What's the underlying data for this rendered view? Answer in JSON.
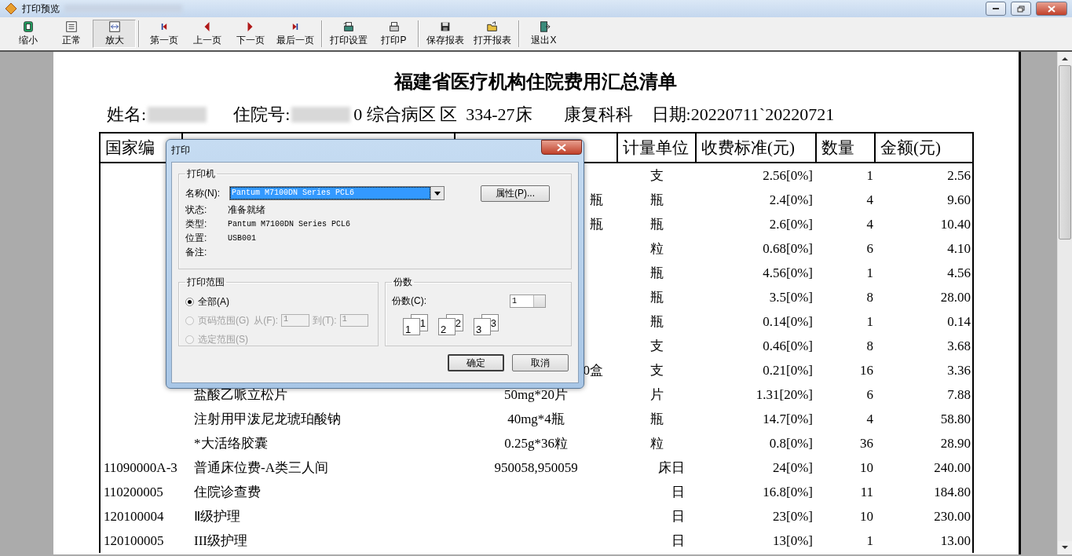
{
  "window": {
    "title": "打印预览"
  },
  "toolbar": [
    {
      "label": "缩小",
      "kind": "zoom-out",
      "pressed": false,
      "separator_before": false
    },
    {
      "label": "正常",
      "kind": "normal",
      "pressed": false,
      "separator_before": false
    },
    {
      "label": "放大",
      "kind": "zoom-in",
      "pressed": true,
      "separator_before": false
    },
    {
      "label": "第一页",
      "kind": "first",
      "pressed": false,
      "separator_before": true
    },
    {
      "label": "上一页",
      "kind": "prev",
      "pressed": false,
      "separator_before": false
    },
    {
      "label": "下一页",
      "kind": "next",
      "pressed": false,
      "separator_before": false
    },
    {
      "label": "最后一页",
      "kind": "last",
      "pressed": false,
      "separator_before": false
    },
    {
      "label": "打印设置",
      "kind": "print-setup",
      "pressed": false,
      "separator_before": true
    },
    {
      "label": "打印P",
      "kind": "print",
      "pressed": false,
      "separator_before": false
    },
    {
      "label": "保存报表",
      "kind": "save",
      "pressed": false,
      "separator_before": true
    },
    {
      "label": "打开报表",
      "kind": "open",
      "pressed": false,
      "separator_before": false
    },
    {
      "label": "退出X",
      "kind": "exit",
      "pressed": false,
      "separator_before": true
    }
  ],
  "report": {
    "title": "福建省医疗机构住院费用汇总清单",
    "name_label": "姓名:",
    "admission_label": "住院号:",
    "ward": "0 综合病区 区  334-27床",
    "department": "康复科科",
    "date": "日期:20220711`20220721",
    "columns": [
      "国家编",
      "计量单位",
      "收费标准(元)",
      "数量",
      "金额(元)"
    ],
    "rows": [
      {
        "kind": "drug",
        "unit": "支",
        "price": "2.56[0%]",
        "qty": "1",
        "amount": "2.56"
      },
      {
        "kind": "drug",
        "spec": "瓶",
        "unit": "瓶",
        "price": "2.4[0%]",
        "qty": "4",
        "amount": "9.60"
      },
      {
        "kind": "drug",
        "spec": "瓶",
        "unit": "瓶",
        "price": "2.6[0%]",
        "qty": "4",
        "amount": "10.40"
      },
      {
        "kind": "drug",
        "unit": "粒",
        "price": "0.68[0%]",
        "qty": "6",
        "amount": "4.10"
      },
      {
        "kind": "drug",
        "unit": "瓶",
        "price": "4.56[0%]",
        "qty": "1",
        "amount": "4.56"
      },
      {
        "kind": "drug",
        "unit": "瓶",
        "price": "3.5[0%]",
        "qty": "8",
        "amount": "28.00"
      },
      {
        "kind": "drug",
        "unit": "瓶",
        "price": "0.14[0%]",
        "qty": "1",
        "amount": "0.14"
      },
      {
        "kind": "drug",
        "unit": "支",
        "price": "0.46[0%]",
        "qty": "8",
        "amount": "3.68"
      },
      {
        "kind": "drug",
        "spec": "0盒",
        "unit": "支",
        "price": "0.21[0%]",
        "qty": "16",
        "amount": "3.36"
      },
      {
        "kind": "drug",
        "name": "盐酸乙哌立松片",
        "spec": "50mg*20片",
        "unit": "片",
        "price": "1.31[20%]",
        "qty": "6",
        "amount": "7.88"
      },
      {
        "kind": "drug",
        "name": "注射用甲泼尼龙琥珀酸钠",
        "spec": "40mg*4瓶",
        "unit": "瓶",
        "price": "14.7[0%]",
        "qty": "4",
        "amount": "58.80"
      },
      {
        "kind": "drug",
        "name": "*大活络胶囊",
        "spec": "0.25g*36粒",
        "unit": "粒",
        "price": "0.8[0%]",
        "qty": "36",
        "amount": "28.90"
      },
      {
        "kind": "service",
        "code": "11090000A-3",
        "name": "普通床位费-A类三人间",
        "spec": "950058,950059",
        "unit": "床日",
        "price": "24[0%]",
        "qty": "10",
        "amount": "240.00"
      },
      {
        "kind": "service",
        "code": "110200005",
        "name": "住院诊查费",
        "unit": "日",
        "price": "16.8[0%]",
        "qty": "11",
        "amount": "184.80"
      },
      {
        "kind": "service",
        "code": "120100004",
        "name": "Ⅱ级护理",
        "unit": "日",
        "price": "23[0%]",
        "qty": "10",
        "amount": "230.00"
      },
      {
        "kind": "service",
        "code": "120100005",
        "name": "III级护理",
        "unit": "日",
        "price": "13[0%]",
        "qty": "1",
        "amount": "13.00"
      }
    ]
  },
  "dialog": {
    "title": "打印",
    "printer_group": "打印机",
    "name_label": "名称(N):",
    "printer_name": "Pantum M7100DN Series PCL6",
    "properties_button": "属性(P)...",
    "info": [
      {
        "label": "状态:",
        "value": "准备就绪"
      },
      {
        "label": "类型:",
        "value": "Pantum M7100DN Series PCL6"
      },
      {
        "label": "位置:",
        "value": "USB001"
      },
      {
        "label": "备注:"
      }
    ],
    "range_group": "打印范围",
    "range_options": [
      {
        "label": "全部(A)",
        "selected": true,
        "disabled": false
      },
      {
        "label": "页码范围(G)",
        "selected": false,
        "disabled": true
      },
      {
        "label": "选定范围(S)",
        "selected": false,
        "disabled": true
      }
    ],
    "from_label": "从(F):",
    "from_value": "1",
    "to_label": "到(T):",
    "to_value": "1",
    "copies_group": "份数",
    "copies_label": "份数(C):",
    "copies_value": "1",
    "collate_pages": [
      "1",
      "1",
      "2",
      "2",
      "3",
      "3"
    ],
    "buttons": [
      {
        "label": "确定",
        "default": true
      },
      {
        "label": "取消",
        "default": false
      }
    ]
  }
}
